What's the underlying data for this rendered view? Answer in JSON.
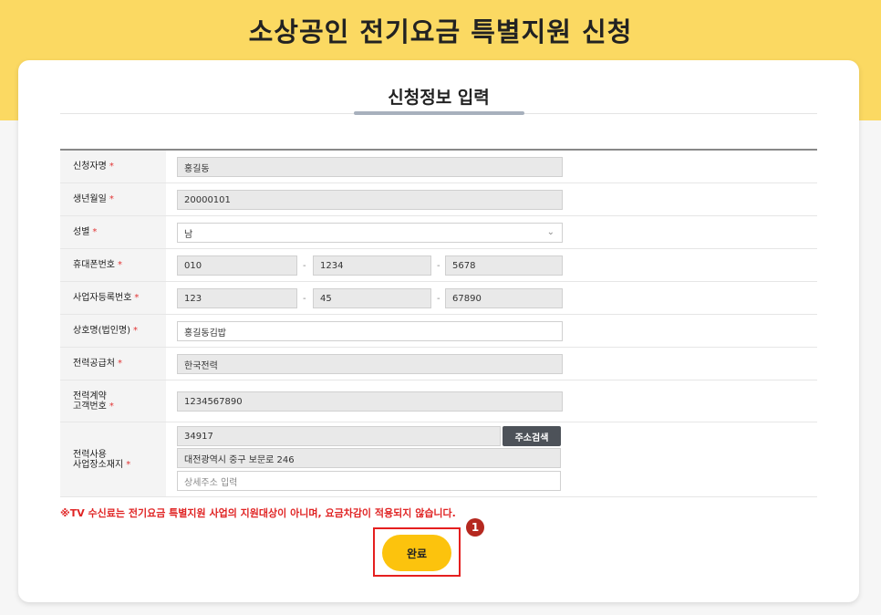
{
  "page": {
    "title": "소상공인 전기요금 특별지원 신청"
  },
  "card": {
    "title": "신청정보 입력"
  },
  "form": {
    "required_mark": "*",
    "applicant_name": {
      "label": "신청자명",
      "value": "홍길동"
    },
    "birth_date": {
      "label": "생년월일",
      "value": "20000101"
    },
    "gender": {
      "label": "성별",
      "value": "남"
    },
    "phone": {
      "label": "휴대폰번호",
      "part1": "010",
      "part2": "1234",
      "part3": "5678",
      "separator": "-"
    },
    "business_number": {
      "label": "사업자등록번호",
      "part1": "123",
      "part2": "45",
      "part3": "67890",
      "separator": "-"
    },
    "company_name": {
      "label": "상호명(법인명)",
      "value": "홍길동김밥"
    },
    "power_supplier": {
      "label": "전력공급처",
      "value": "한국전력"
    },
    "customer_number": {
      "label_line1": "전력계약",
      "label_line2": "고객번호",
      "value": "1234567890"
    },
    "address": {
      "label_line1": "전력사용",
      "label_line2": "사업장소재지",
      "zipcode": "34917",
      "search_label": "주소검색",
      "road_address": "대전광역시 중구 보문로 246",
      "detail_placeholder": "상세주소 입력"
    }
  },
  "notice": "※TV 수신료는 전기요금 특별지원 사업의 지원대상이 아니며, 요금차감이 적용되지 않습니다.",
  "submit": {
    "label": "완료"
  },
  "annotation": {
    "badge_number": "1",
    "highlight_color": "#e51f1f"
  },
  "colors": {
    "banner": "#fbd962",
    "submit_button": "#fcc30d",
    "required": "#e23535",
    "notice": "#e02424"
  }
}
